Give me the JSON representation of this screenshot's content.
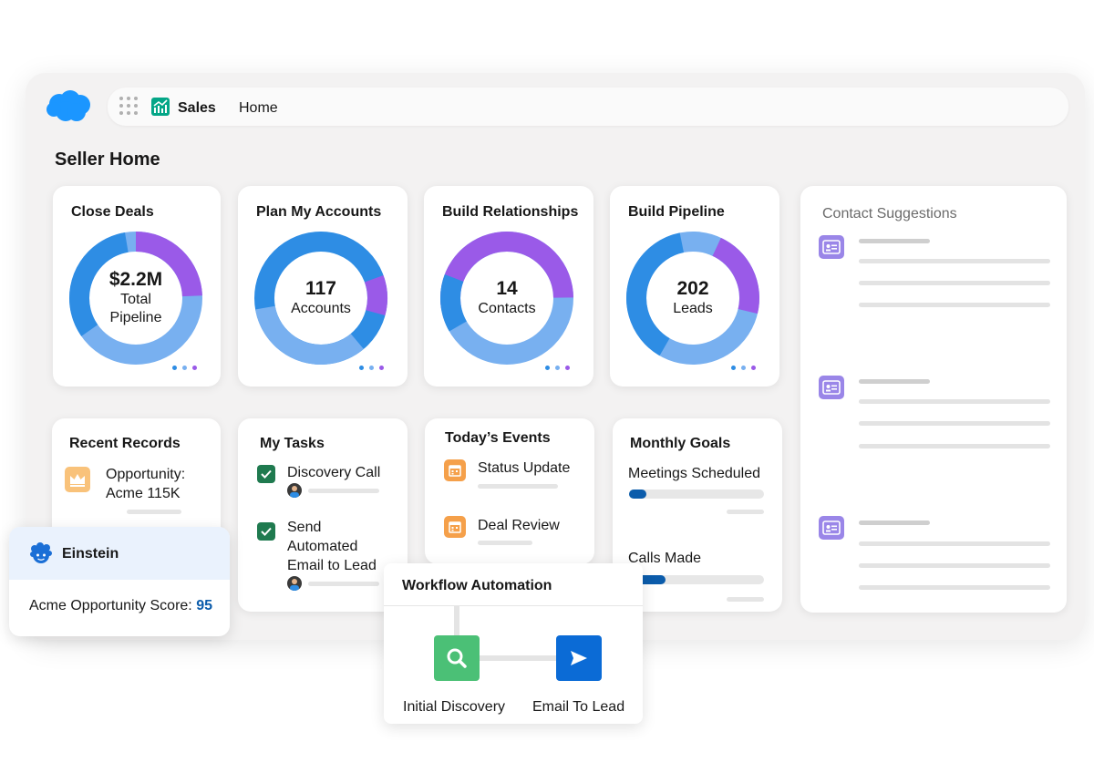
{
  "header": {
    "app_name": "Sales",
    "nav_home": "Home"
  },
  "page": {
    "title": "Seller Home"
  },
  "colors": {
    "brand_blue": "#1b96ff",
    "ring_blue": "#2e8de4",
    "ring_light_blue": "#78b0f0",
    "ring_purple": "#9a5ae8",
    "task_check": "#1f7a4f",
    "event_orange": "#f5a04a",
    "progress_blue": "#0b5cab",
    "contact_purple": "#9a86e8",
    "node_green": "#4bc076",
    "node_blue": "#0b6bd6"
  },
  "metrics": [
    {
      "title": "Close Deals",
      "value": "$2.2M",
      "label": "Total Pipeline"
    },
    {
      "title": "Plan My Accounts",
      "value": "117",
      "label": "Accounts"
    },
    {
      "title": "Build Relationships",
      "value": "14",
      "label": "Contacts"
    },
    {
      "title": "Build Pipeline",
      "value": "202",
      "label": "Leads"
    }
  ],
  "recent_records": {
    "title": "Recent Records",
    "items": [
      {
        "label": "Opportunity: Acme 115K",
        "icon": "crown-icon"
      }
    ]
  },
  "my_tasks": {
    "title": "My Tasks",
    "items": [
      {
        "label": "Discovery Call",
        "done": true
      },
      {
        "label": "Send Automated Email to Lead",
        "done": true
      }
    ]
  },
  "todays_events": {
    "title": "Today’s Events",
    "items": [
      {
        "label": "Status Update",
        "icon": "calendar-icon"
      },
      {
        "label": "Deal Review",
        "icon": "calendar-icon"
      }
    ]
  },
  "monthly_goals": {
    "title": "Monthly Goals",
    "goals": [
      {
        "label": "Meetings Scheduled",
        "progress": 0.13
      },
      {
        "label": "Calls Made",
        "progress": 0.27
      }
    ]
  },
  "contact_suggestions": {
    "title": "Contact Suggestions",
    "items": [
      {
        "icon": "contact-card-icon"
      },
      {
        "icon": "contact-card-icon"
      },
      {
        "icon": "contact-card-icon"
      }
    ]
  },
  "einstein": {
    "name": "Einstein",
    "score_label": "Acme Opportunity Score:",
    "score_value": "95"
  },
  "workflow": {
    "title": "Workflow Automation",
    "steps": [
      {
        "label": "Initial Discovery",
        "icon": "search-icon"
      },
      {
        "label": "Email To Lead",
        "icon": "send-icon"
      }
    ]
  }
}
